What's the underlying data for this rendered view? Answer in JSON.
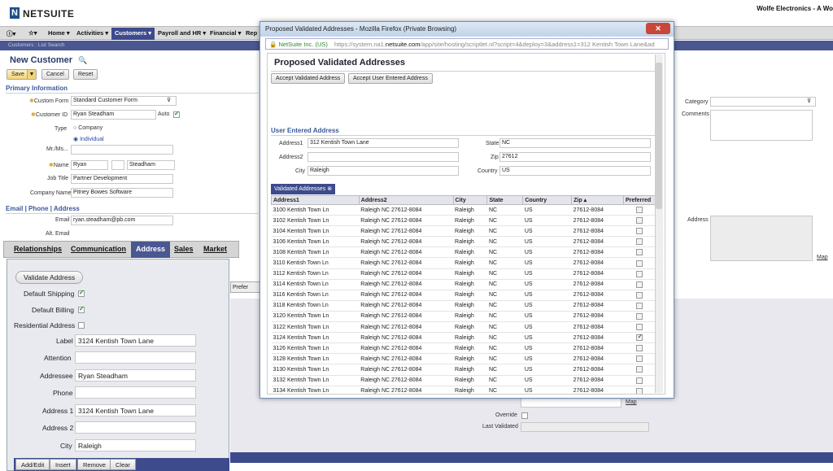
{
  "header": {
    "logo_mark": "N",
    "logo": "NETSUITE",
    "company": "Wolfe Electronics - A Wo"
  },
  "nav": {
    "items": [
      "Home ▾",
      "Activities ▾",
      "Customers ▾",
      "Payroll and HR ▾",
      "Financial ▾",
      "Rep"
    ],
    "crumb": "Customers : List  Search"
  },
  "record": {
    "title": "New Customer",
    "save": "Save",
    "cancel": "Cancel",
    "reset": "Reset",
    "primary_info": "Primary Information",
    "custom_form_label": "Custom Form",
    "custom_form": "Standard Customer Form",
    "customer_id_label": "Customer ID",
    "customer_id": "Ryan Steadham",
    "auto_label": "Auto",
    "type_label": "Type",
    "type_company": "Company",
    "type_individual": "Individual",
    "mr_label": "Mr./Ms...",
    "name_label": "Name",
    "first_name": "Ryan",
    "last_name": "Steadham",
    "job_title_label": "Job Title",
    "job_title": "Partner Development",
    "company_name_label": "Company Name",
    "company_name": "Pitney Bowes Software",
    "email_section": "Email | Phone | Address",
    "email_label": "Email",
    "email": "ryan.steadham@pb.com",
    "alt_email_label": "Alt. Email",
    "category_label": "Category",
    "comments_label": "Comments",
    "address_label": "Address",
    "map": "Map"
  },
  "tabs": [
    "Relationships",
    "Communication",
    "Address",
    "Sales",
    "Market"
  ],
  "address_panel": {
    "validate": "Validate Address",
    "default_shipping": "Default Shipping",
    "default_billing": "Default Billing",
    "residential": "Residential Address",
    "label_l": "Label",
    "label_v": "3124 Kentish Town Lane",
    "attention_l": "Attention",
    "addressee_l": "Addressee",
    "addressee_v": "Ryan Steadham",
    "phone_l": "Phone",
    "address1_l": "Address 1",
    "address1_v": "3124 Kentish Town Lane",
    "address2_l": "Address 2",
    "city_l": "City",
    "city_v": "Raleigh",
    "add_edit": "Add/Edit",
    "insert": "Insert",
    "remove": "Remove",
    "clear": "Clear",
    "pref_tab": "Prefer"
  },
  "background": {
    "override": "Override",
    "last_validated": "Last Validated",
    "map": "Map"
  },
  "popup": {
    "title": "Proposed Validated Addresses - Mozilla Firefox (Private Browsing)",
    "close": "✕",
    "url_security": "NetSuite Inc. (US)",
    "url_prefix": "https://system.na1.",
    "url_domain": "netsuite.com",
    "url_rest": "/app/site/hosting/scriptlet.nl?script=4&deploy=3&address1=312 Kentish Town Lane&ad",
    "heading": "Proposed Validated Addresses",
    "accept_validated": "Accept Validated Address",
    "accept_user": "Accept User Entered Address",
    "user_section": "User Entered Address",
    "address1_l": "Address1",
    "address1_v": "312 Kentish Town Lane",
    "address2_l": "Address2",
    "city_l": "City",
    "city_v": "Raleigh",
    "state_l": "State",
    "state_v": "NC",
    "zip_l": "Zip",
    "zip_v": "27612",
    "country_l": "Country",
    "country_v": "US",
    "validated_tab": "Validated Addresses ⊗",
    "columns": [
      "Address1",
      "Address2",
      "City",
      "State",
      "Country",
      "Zip ▴",
      "Preferred"
    ],
    "rows": [
      [
        "3100 Kentish Town Ln",
        "Raleigh NC 27612-8084",
        "Raleigh",
        "NC",
        "US",
        "27612-8084"
      ],
      [
        "3102 Kentish Town Ln",
        "Raleigh NC 27612-8084",
        "Raleigh",
        "NC",
        "US",
        "27612-8084"
      ],
      [
        "3104 Kentish Town Ln",
        "Raleigh NC 27612-8084",
        "Raleigh",
        "NC",
        "US",
        "27612-8084"
      ],
      [
        "3106 Kentish Town Ln",
        "Raleigh NC 27612-8084",
        "Raleigh",
        "NC",
        "US",
        "27612-8084"
      ],
      [
        "3108 Kentish Town Ln",
        "Raleigh NC 27612-8084",
        "Raleigh",
        "NC",
        "US",
        "27612-8084"
      ],
      [
        "3110 Kentish Town Ln",
        "Raleigh NC 27612-8084",
        "Raleigh",
        "NC",
        "US",
        "27612-8084"
      ],
      [
        "3112 Kentish Town Ln",
        "Raleigh NC 27612-8084",
        "Raleigh",
        "NC",
        "US",
        "27612-8084"
      ],
      [
        "3114 Kentish Town Ln",
        "Raleigh NC 27612-8084",
        "Raleigh",
        "NC",
        "US",
        "27612-8084"
      ],
      [
        "3116 Kentish Town Ln",
        "Raleigh NC 27612-8084",
        "Raleigh",
        "NC",
        "US",
        "27612-8084"
      ],
      [
        "3118 Kentish Town Ln",
        "Raleigh NC 27612-8084",
        "Raleigh",
        "NC",
        "US",
        "27612-8084"
      ],
      [
        "3120 Kentish Town Ln",
        "Raleigh NC 27612-8084",
        "Raleigh",
        "NC",
        "US",
        "27612-8084"
      ],
      [
        "3122 Kentish Town Ln",
        "Raleigh NC 27612-8084",
        "Raleigh",
        "NC",
        "US",
        "27612-8084"
      ],
      [
        "3124 Kentish Town Ln",
        "Raleigh NC 27612-8084",
        "Raleigh",
        "NC",
        "US",
        "27612-8084"
      ],
      [
        "3126 Kentish Town Ln",
        "Raleigh NC 27612-8084",
        "Raleigh",
        "NC",
        "US",
        "27612-8084"
      ],
      [
        "3128 Kentish Town Ln",
        "Raleigh NC 27612-8084",
        "Raleigh",
        "NC",
        "US",
        "27612-8084"
      ],
      [
        "3130 Kentish Town Ln",
        "Raleigh NC 27612-8084",
        "Raleigh",
        "NC",
        "US",
        "27612-8084"
      ],
      [
        "3132 Kentish Town Ln",
        "Raleigh NC 27612-8084",
        "Raleigh",
        "NC",
        "US",
        "27612-8084"
      ],
      [
        "3134 Kentish Town Ln",
        "Raleigh NC 27612-8084",
        "Raleigh",
        "NC",
        "US",
        "27612-8084"
      ],
      [
        "3136 Kentish Town Ln",
        "Raleigh NC 27612-8084",
        "Raleigh",
        "NC",
        "US",
        "27612-8084"
      ],
      [
        "3138 Kentish Town Ln",
        "Raleigh NC 27612-8084",
        "Raleigh",
        "NC",
        "US",
        "27612-8084"
      ]
    ],
    "preferred_row": 12
  }
}
